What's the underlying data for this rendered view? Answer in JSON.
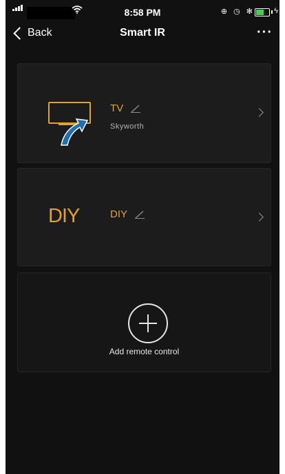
{
  "status_bar": {
    "time": "8:58 PM",
    "icons": "⊕ ◷ ✻",
    "bolt": "ϟ"
  },
  "header": {
    "back_label": "Back",
    "title": "Smart IR",
    "more": "···"
  },
  "devices": [
    {
      "name": "TV",
      "brand": "Skyworth",
      "icon": "tv-icon"
    },
    {
      "name": "DIY",
      "badge": "DIY",
      "icon": "diy-icon"
    }
  ],
  "add_card": {
    "label": "Add remote control"
  },
  "colors": {
    "accent": "#e2a328",
    "background": "#111111",
    "card": "#1c1c1c",
    "arrow": "#1f6fb5",
    "battery": "#3fd24f"
  }
}
